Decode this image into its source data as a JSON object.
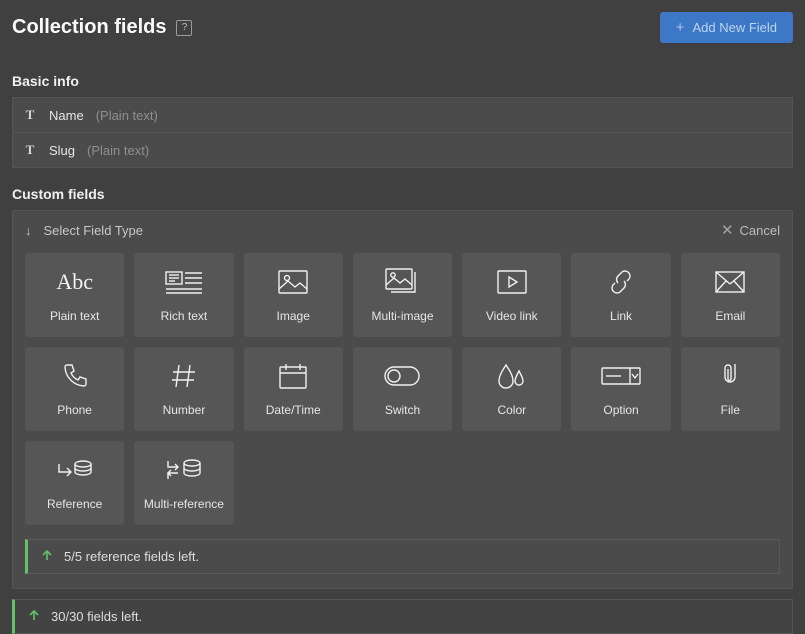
{
  "header": {
    "title": "Collection fields",
    "helpGlyph": "?",
    "addButton": "Add New Field"
  },
  "basicInfo": {
    "label": "Basic info",
    "fields": [
      {
        "name": "Name",
        "type": "(Plain text)"
      },
      {
        "name": "Slug",
        "type": "(Plain text)"
      }
    ]
  },
  "customFields": {
    "label": "Custom fields",
    "panelTitle": "Select Field Type",
    "cancel": "Cancel",
    "types": [
      {
        "key": "plain-text",
        "label": "Plain text"
      },
      {
        "key": "rich-text",
        "label": "Rich text"
      },
      {
        "key": "image",
        "label": "Image"
      },
      {
        "key": "multi-image",
        "label": "Multi-image"
      },
      {
        "key": "video-link",
        "label": "Video link"
      },
      {
        "key": "link",
        "label": "Link"
      },
      {
        "key": "email",
        "label": "Email"
      },
      {
        "key": "phone",
        "label": "Phone"
      },
      {
        "key": "number",
        "label": "Number"
      },
      {
        "key": "datetime",
        "label": "Date/Time"
      },
      {
        "key": "switch",
        "label": "Switch"
      },
      {
        "key": "color",
        "label": "Color"
      },
      {
        "key": "option",
        "label": "Option"
      },
      {
        "key": "file",
        "label": "File"
      },
      {
        "key": "reference",
        "label": "Reference"
      },
      {
        "key": "multi-reference",
        "label": "Multi-reference"
      }
    ],
    "refStatus": "5/5 reference fields left."
  },
  "totalStatus": "30/30 fields left."
}
